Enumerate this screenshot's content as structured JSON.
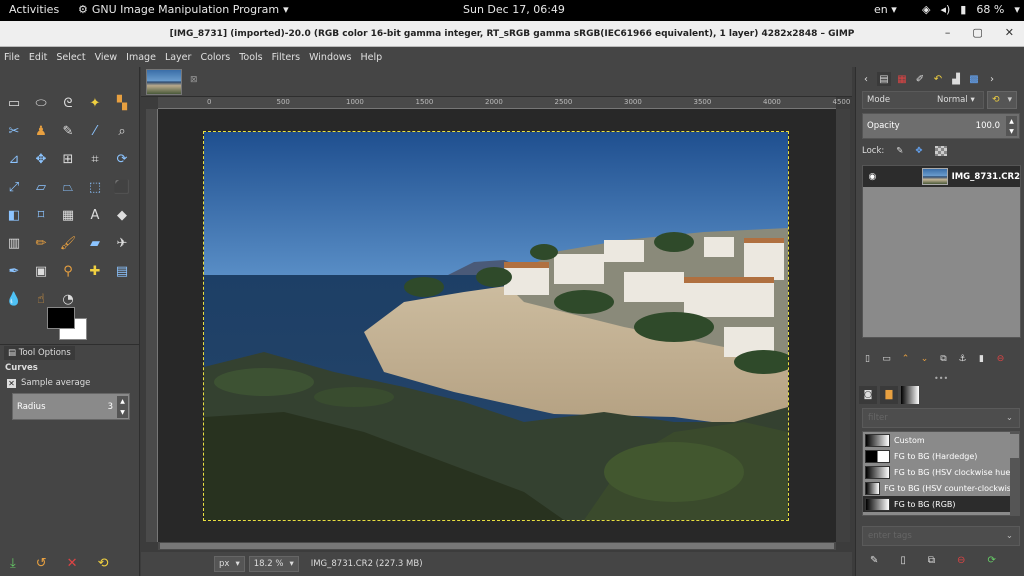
{
  "topbar": {
    "activities": "Activities",
    "app_name": "GNU Image Manipulation Program",
    "clock": "Sun Dec 17, 06:49",
    "lang": "en",
    "battery": "68 %"
  },
  "window": {
    "title": "[IMG_8731] (imported)-20.0 (RGB color 16-bit gamma integer, RT_sRGB gamma sRGB(IEC61966 equivalent), 1 layer) 4282x2848 – GIMP"
  },
  "menu": [
    "File",
    "Edit",
    "Select",
    "View",
    "Image",
    "Layer",
    "Colors",
    "Tools",
    "Filters",
    "Windows",
    "Help"
  ],
  "tool_options": {
    "tab_label": "Tool Options",
    "tool_name": "Curves",
    "sample_average_label": "Sample average",
    "radius_label": "Radius",
    "radius_value": "3"
  },
  "ruler": {
    "ticks": [
      "0",
      "500",
      "1000",
      "1500",
      "2000",
      "2500",
      "3000",
      "3500",
      "4000",
      "4500"
    ]
  },
  "status": {
    "unit": "px",
    "zoom": "18.2 %",
    "file_info": "IMG_8731.CR2 (227.3 MB)"
  },
  "layers_panel": {
    "mode_label": "Mode",
    "mode_value": "Normal",
    "opacity_label": "Opacity",
    "opacity_value": "100.0",
    "lock_label": "Lock:",
    "layer_name": "IMG_8731.CR2"
  },
  "gradients_panel": {
    "filter_placeholder": "filter",
    "items": [
      "Custom",
      "FG to BG (Hardedge)",
      "FG to BG (HSV clockwise hue)",
      "FG to BG (HSV counter-clockwise)",
      "FG to BG (RGB)"
    ],
    "selected": 4,
    "tag_placeholder": "enter tags"
  },
  "colors": {
    "foreground": "#000000",
    "background": "#ffffff",
    "selection": "#e8e040"
  }
}
